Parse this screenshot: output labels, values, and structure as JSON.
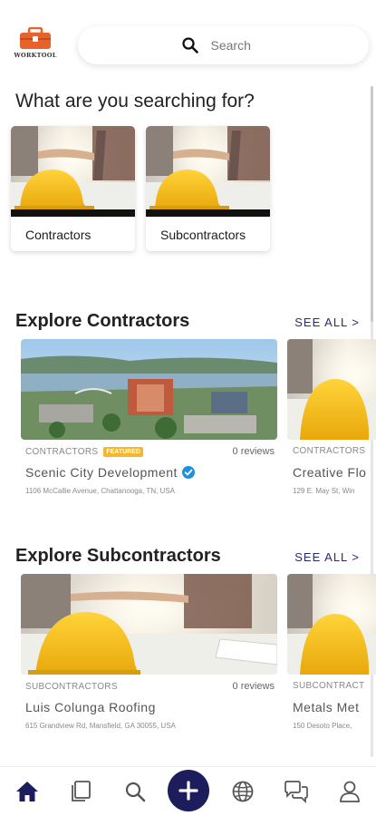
{
  "header": {
    "logo_text": "WORKTOOL",
    "search_placeholder": "Search"
  },
  "page_title": "What are you searching for?",
  "categories": [
    {
      "label": "Contractors"
    },
    {
      "label": "Subcontractors"
    }
  ],
  "contractors_section": {
    "title": "Explore Contractors",
    "see_all": "SEE ALL >",
    "items": [
      {
        "category": "CONTRACTORS",
        "badge": "FEATURED",
        "reviews": "0 reviews",
        "name": "Scenic City Development",
        "address": "1106 McCallie Avenue, Chattanooga, TN, USA",
        "verified": true
      },
      {
        "category": "CONTRACTORS",
        "name": "Creative Flo",
        "address": "129 E. May St, Win"
      }
    ]
  },
  "subcontractors_section": {
    "title": "Explore Subcontractors",
    "see_all": "SEE ALL >",
    "items": [
      {
        "category": "SUBCONTRACTORS",
        "reviews": "0 reviews",
        "name": "Luis Colunga Roofing",
        "address": "615 Grandview Rd, Mansfield, GA 30055, USA"
      },
      {
        "category": "SUBCONTRACT",
        "name": "Metals Met",
        "address": "150 Desoto Place,"
      }
    ]
  },
  "bottom_nav": {
    "items": [
      "home-icon",
      "listings-icon",
      "search-icon",
      "add-icon",
      "globe-icon",
      "chat-icon",
      "profile-icon"
    ],
    "active": "home-icon",
    "accent_color": "#1d1d5e"
  },
  "colors": {
    "accent": "#1d1d5e",
    "see_all": "#2c2a6a",
    "featured_badge": "#f7b62c",
    "verified": "#1f8fe0",
    "logo": "#e8622c"
  }
}
